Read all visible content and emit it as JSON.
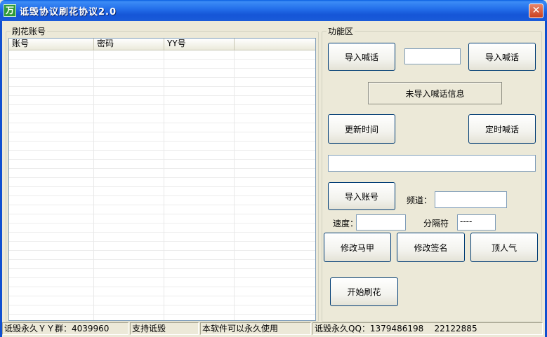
{
  "window": {
    "title": "诋毁协议刷花协议2.0",
    "app_icon_glyph": "万"
  },
  "accounts_group": {
    "legend": "刷花账号",
    "columns": [
      "账号",
      "密码",
      "YY号",
      ""
    ]
  },
  "functions_group": {
    "legend": "功能区",
    "import_shout_btn_1": "导入喊话",
    "import_shout_btn_2": "导入喊话",
    "shout_input_value": "",
    "not_imported_info": "未导入喊话信息",
    "update_time_btn": "更新时间",
    "scheduled_shout_btn": "定时喊话",
    "long_input_value": "",
    "import_account_btn": "导入账号",
    "channel_label": "频道：",
    "channel_value": "",
    "speed_label": "速度：",
    "speed_value": "",
    "separator_label": "分隔符",
    "separator_value": "----",
    "modify_vest_btn": "修改马甲",
    "modify_signature_btn": "修改签名",
    "boost_popularity_btn": "顶人气",
    "start_btn": "开始刷花"
  },
  "statusbar": {
    "pane1": "诋毁永久ＹＹ群：4039960",
    "pane2": "支持诋毁",
    "pane3": "本软件可以永久使用",
    "pane4": "诋毁永久QQ：1379486198    22122885"
  }
}
